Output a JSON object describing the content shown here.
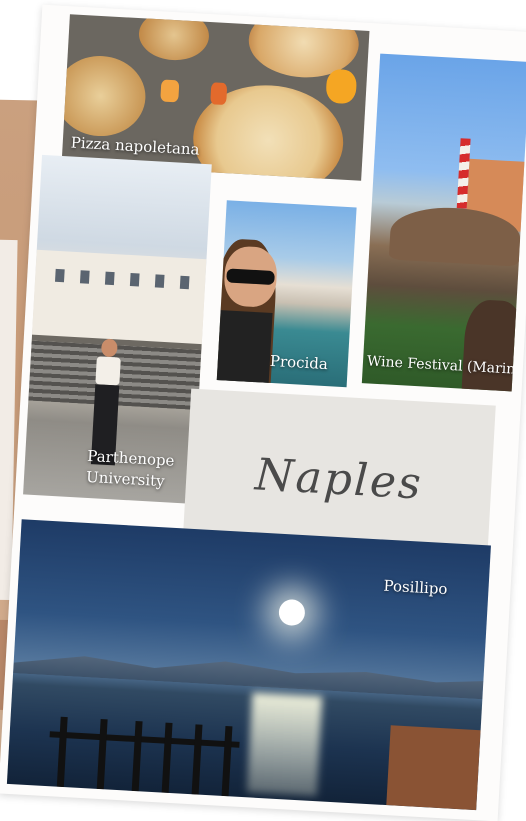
{
  "collage": {
    "photos": [
      {
        "id": "pizza",
        "caption": "Pizza napoletana"
      },
      {
        "id": "wine",
        "caption": "Wine Festival (Marino)"
      },
      {
        "id": "university",
        "caption_line1": "Parthenope",
        "caption_line2": "University"
      },
      {
        "id": "procida",
        "caption": "Procida"
      },
      {
        "id": "posillipo",
        "caption": "Posillipo"
      }
    ],
    "title": "Naples"
  },
  "colors": {
    "card": "#fdfcfb",
    "title_box": "#e7e5e1",
    "side_paper": "#c89b78"
  }
}
